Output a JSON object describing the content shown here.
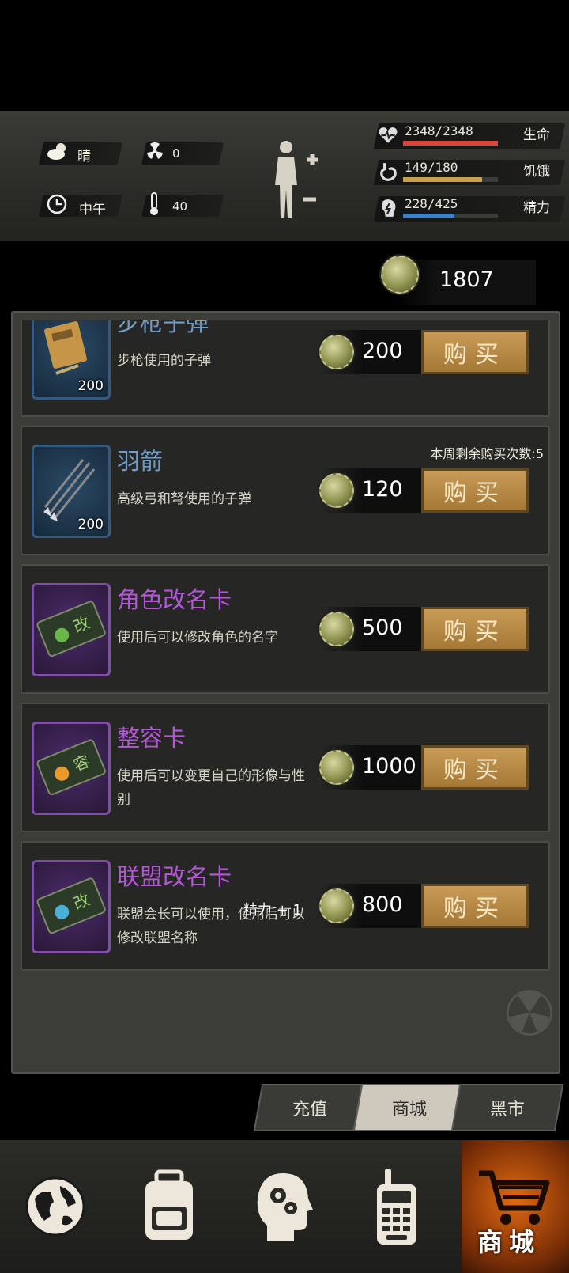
{
  "status": {
    "weather": {
      "icon": "cloud-sun-icon",
      "label": "晴"
    },
    "radiation": {
      "icon": "radiation-icon",
      "value": "0"
    },
    "time_of_day": {
      "icon": "clock-icon",
      "label": "中午"
    },
    "temperature": {
      "icon": "thermometer-icon",
      "value": "40"
    },
    "stats": [
      {
        "key": "health",
        "icon": "heart-pulse-icon",
        "value": "2348/2348",
        "label": "生命",
        "fraction": 1.0,
        "color": "#d9453d"
      },
      {
        "key": "hunger",
        "icon": "stomach-icon",
        "value": "149/180",
        "label": "饥饿",
        "fraction": 0.83,
        "color": "#c9a04e"
      },
      {
        "key": "energy",
        "icon": "brain-bolt-icon",
        "value": "228/425",
        "label": "精力",
        "fraction": 0.54,
        "color": "#3f7fc4"
      }
    ]
  },
  "currency": {
    "icon": "bottle-cap-icon",
    "amount": "1807"
  },
  "items": [
    {
      "name": "步枪子弹",
      "desc": "步枪使用的子弹",
      "qty": "200",
      "price": "200",
      "icon": "rifle-ammo-box-icon",
      "frame": "blue",
      "name_color": "#6f9cc8",
      "weekly_limit": ""
    },
    {
      "name": "羽箭",
      "desc": "高级弓和弩使用的子弹",
      "qty": "200",
      "price": "120",
      "icon": "arrows-icon",
      "frame": "blue",
      "name_color": "#6f9cc8",
      "weekly_limit": "本周剩余购买次数:5"
    },
    {
      "name": "角色改名卡",
      "desc": "使用后可以修改角色的名字",
      "qty": "",
      "price": "500",
      "icon": "rename-card-icon",
      "frame": "purple",
      "name_color": "#b258d6",
      "weekly_limit": ""
    },
    {
      "name": "整容卡",
      "desc": "使用后可以变更自己的形像与性别",
      "qty": "",
      "price": "1000",
      "icon": "appearance-card-icon",
      "frame": "purple",
      "name_color": "#b258d6",
      "weekly_limit": ""
    },
    {
      "name": "联盟改名卡",
      "desc": "联盟会长可以使用，使用后可以修改联盟名称",
      "qty": "",
      "price": "800",
      "icon": "alliance-rename-card-icon",
      "frame": "purple",
      "name_color": "#b258d6",
      "weekly_limit": ""
    }
  ],
  "buy_label": "购买",
  "floating_text": "精力 + 1",
  "tabs": [
    {
      "label": "充值",
      "active": false
    },
    {
      "label": "商城",
      "active": true
    },
    {
      "label": "黑市",
      "active": false
    }
  ],
  "nav": {
    "items": [
      "globe-icon",
      "backpack-icon",
      "head-gears-icon",
      "walkie-talkie-icon",
      "shopping-cart-icon"
    ],
    "active_label": "商城"
  }
}
